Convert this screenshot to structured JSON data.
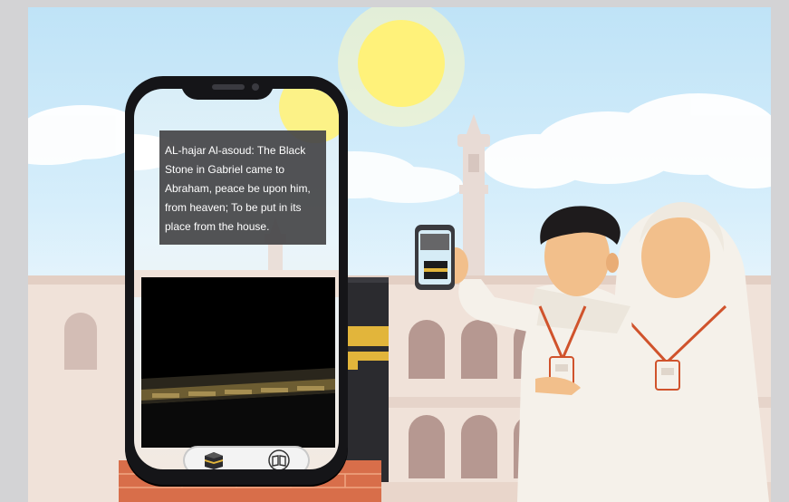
{
  "ar_panel": {
    "description": "AL-hajar Al-asoud: The Black Stone in Gabriel came to Abraham, peace be upon him, from heaven; To be put in its place from the house."
  },
  "toolbar": {
    "buttons": [
      {
        "icon": "kaaba-icon"
      },
      {
        "icon": "book-icon"
      }
    ]
  },
  "colors": {
    "sky": "#cfe9f8",
    "sun": "#fff27a",
    "phone_frame": "#151518",
    "info_box": "#464648",
    "kaaba": "#1c1c1c",
    "gold_band": "#e2b53b",
    "ihram": "#f5f1ea",
    "skin": "#f2bf8b",
    "lanyard": "#d0532c"
  }
}
